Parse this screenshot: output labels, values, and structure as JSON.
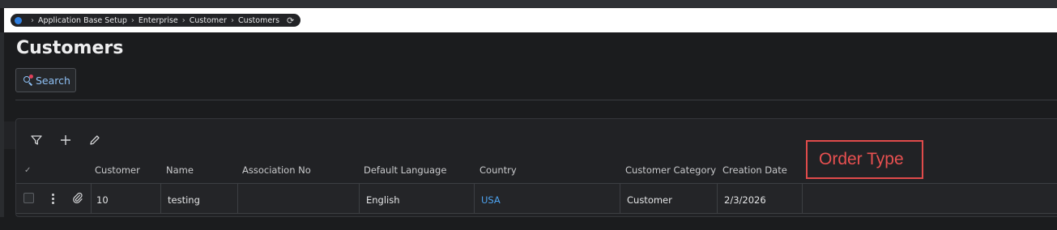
{
  "breadcrumb": {
    "items": [
      "Application Base Setup",
      "Enterprise",
      "Customer",
      "Customers"
    ]
  },
  "page": {
    "title": "Customers"
  },
  "toolbar": {
    "search_label": "Search"
  },
  "table": {
    "columns": [
      "Customer",
      "Name",
      "Association No",
      "Default Language",
      "Country",
      "Customer Category",
      "Creation Date"
    ],
    "rows": [
      {
        "customer": "10",
        "name": "testing",
        "association_no": "",
        "default_language": "English",
        "country": "USA",
        "customer_category": "Customer",
        "creation_date": "2/3/2026"
      }
    ]
  },
  "annotation": {
    "label": "Order Type",
    "color": "#e04b4b"
  },
  "colors": {
    "accent": "#4ea3f0",
    "home": "#2f7fe0",
    "background": "#1b1c1e"
  },
  "icons": [
    "home-icon",
    "chevron-right-icon",
    "refresh-icon",
    "search-icon",
    "filter-icon",
    "plus-icon",
    "pencil-icon",
    "check-icon",
    "kebab-icon",
    "paperclip-icon"
  ]
}
